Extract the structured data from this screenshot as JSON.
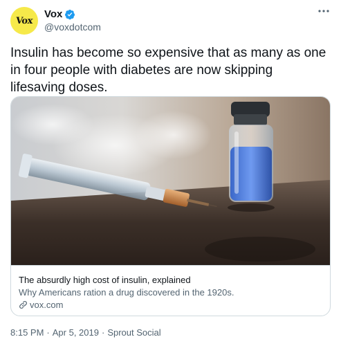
{
  "author": {
    "display_name": "Vox",
    "handle": "@voxdotcom",
    "avatar_text": "Vox",
    "verified": true
  },
  "tweet": {
    "text": "Insulin has become so expensive that as many as one in four people with diabetes are now skipping lifesaving doses."
  },
  "card": {
    "title": "The absurdly high cost of insulin, explained",
    "description": "Why Americans ration a drug discovered in the 1920s.",
    "domain": "vox.com",
    "image_icon": "syringe-and-insulin-vial-photo"
  },
  "footer": {
    "time": "8:15 PM",
    "date": "Apr 5, 2019",
    "source": "Sprout Social"
  },
  "colors": {
    "verified": "#1d9bf0",
    "avatar_bg": "#f6e94a",
    "secondary_text": "#536471",
    "border": "#cfd9de"
  },
  "icons": {
    "more": "more-horizontal-icon",
    "verified": "verified-badge-icon",
    "link": "link-icon"
  }
}
